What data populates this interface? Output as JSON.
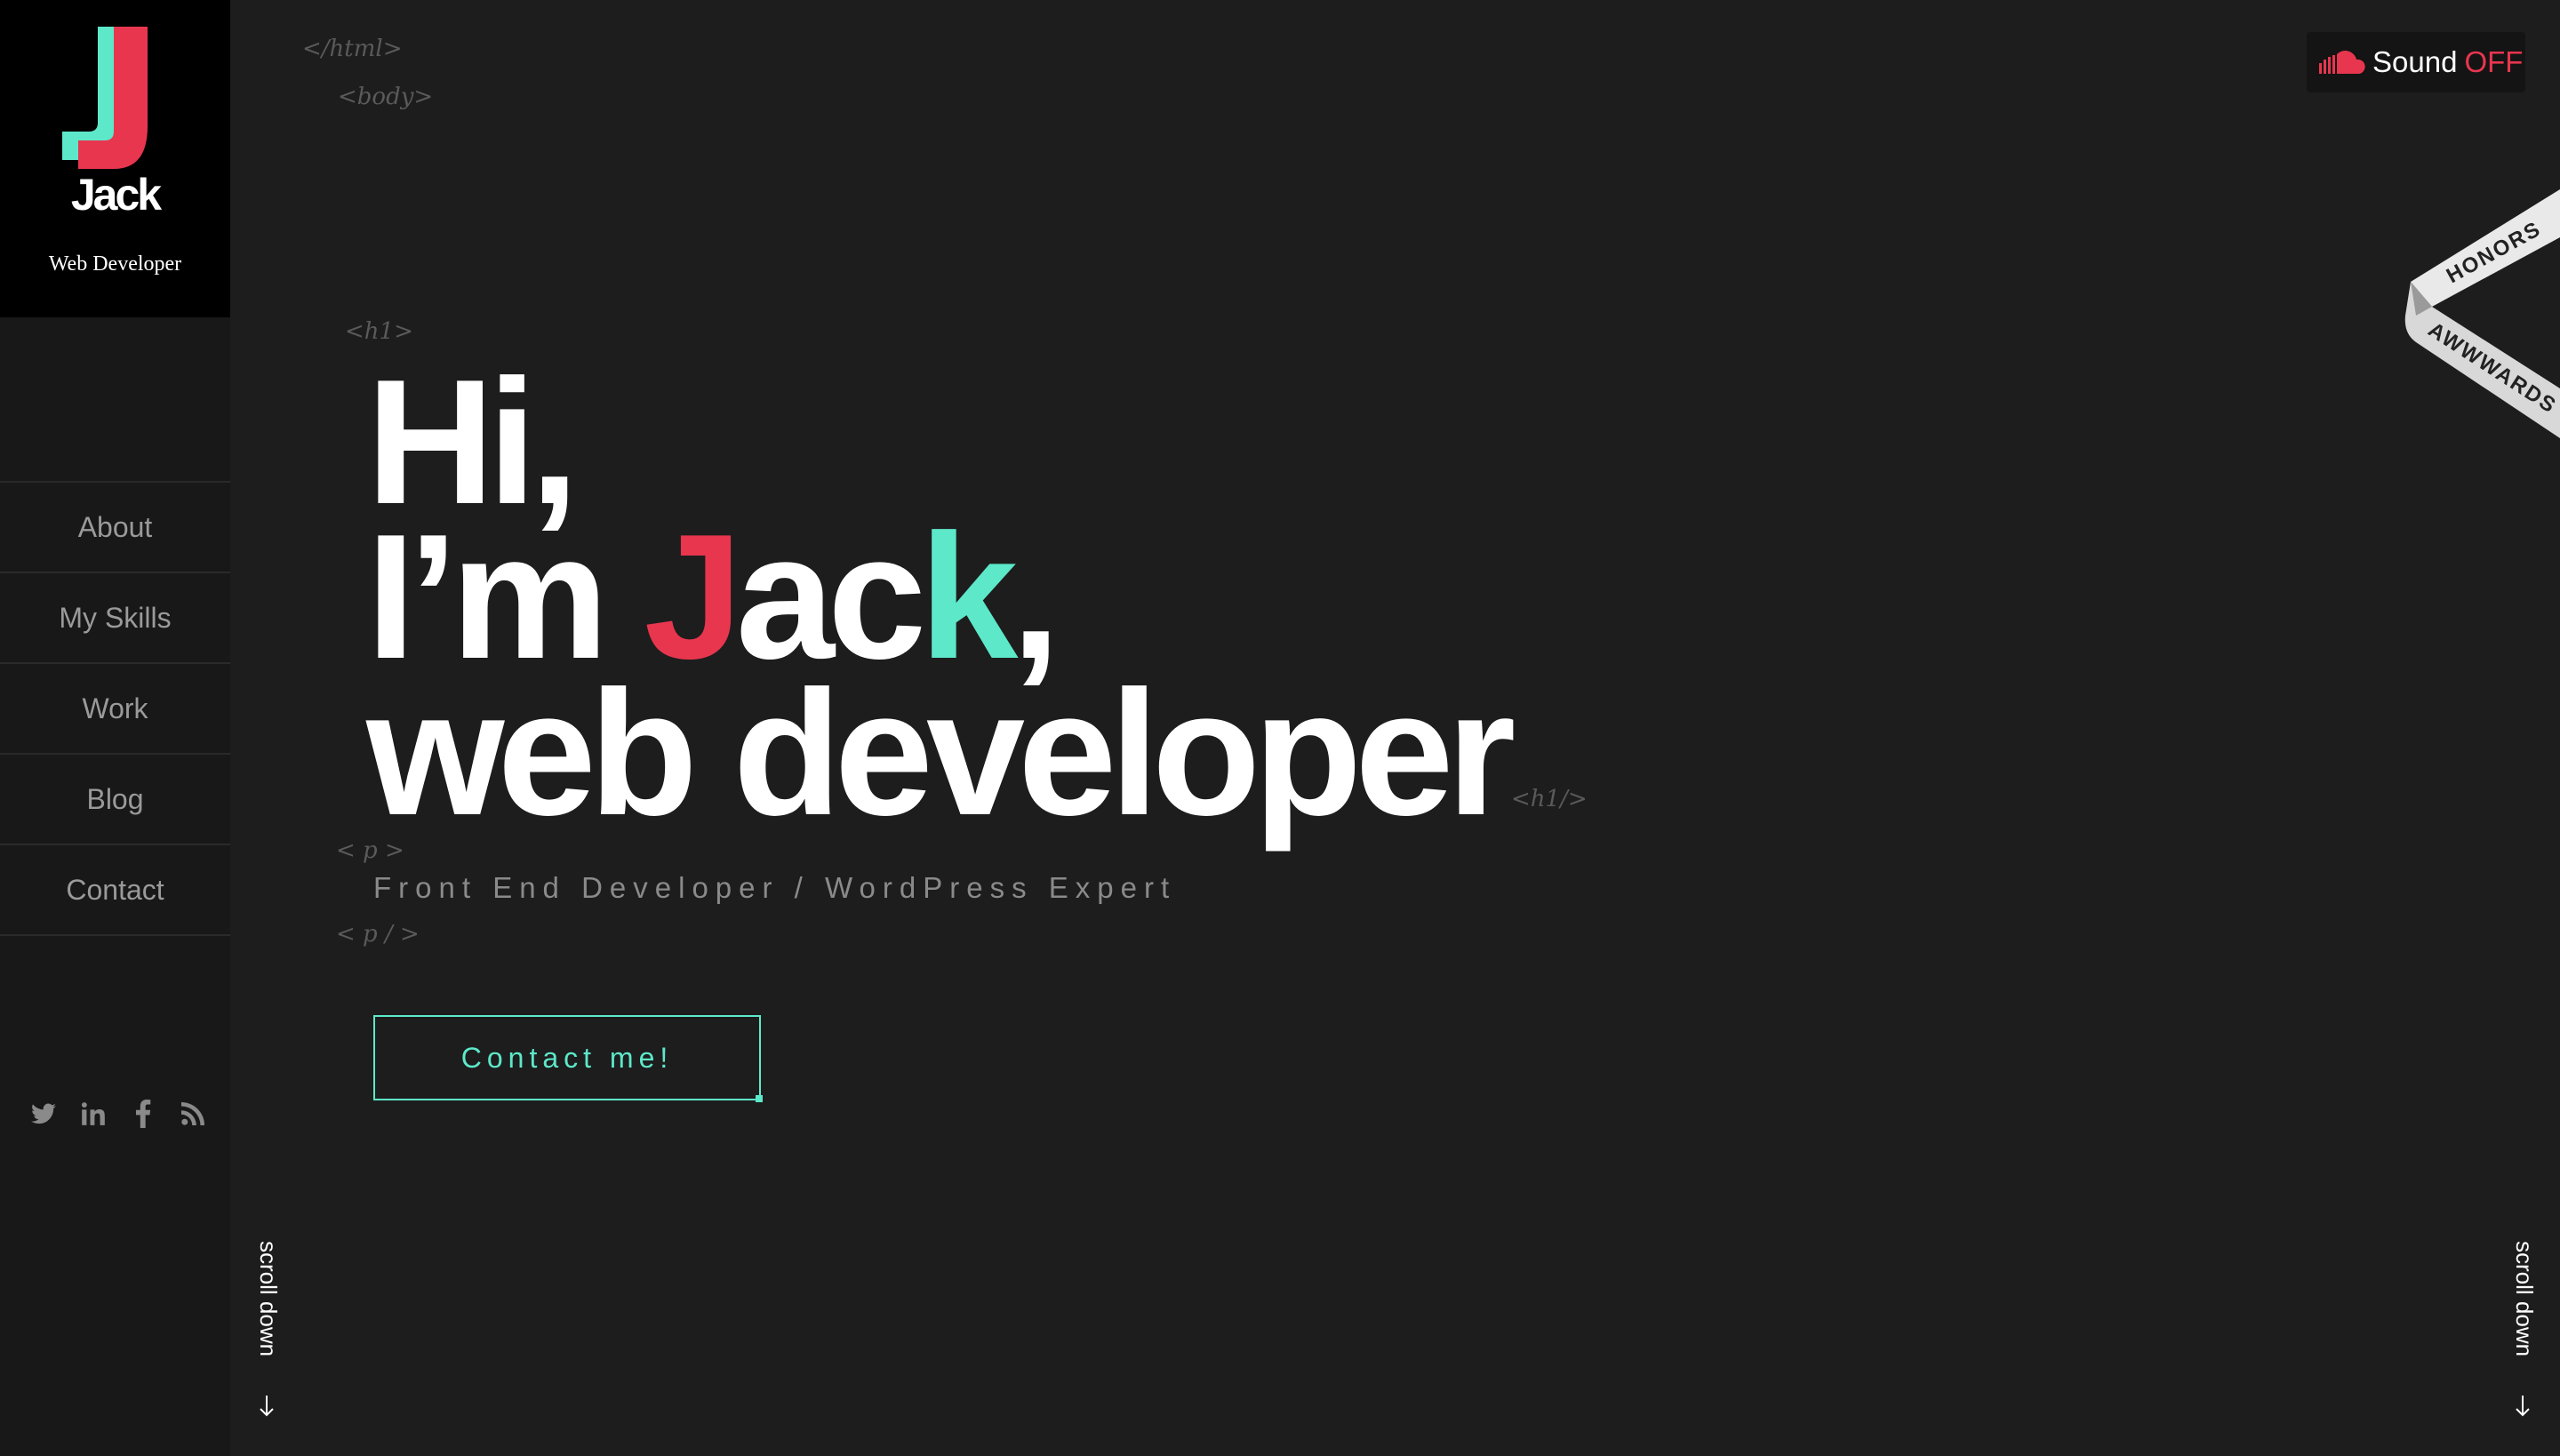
{
  "brand": {
    "name": "Jack",
    "tagline": "Web Developer"
  },
  "nav": {
    "items": [
      {
        "label": "About",
        "key": "about"
      },
      {
        "label": "My Skills",
        "key": "my-skills"
      },
      {
        "label": "Work",
        "key": "work"
      },
      {
        "label": "Blog",
        "key": "blog"
      },
      {
        "label": "Contact",
        "key": "contact"
      }
    ]
  },
  "social": {
    "icons": [
      "twitter-icon",
      "linkedin-icon",
      "facebook-icon",
      "rss-icon"
    ]
  },
  "code_tags": {
    "html_close": "</html>",
    "body_open": "<body>",
    "h1_open": "<h1>",
    "h1_close": "<h1/>",
    "p_open": "< p >",
    "p_close": "< p / >"
  },
  "hero": {
    "line1": "Hi,",
    "line2_prefix": "I’m ",
    "name_j": "J",
    "name_ac": "ac",
    "name_k": "k",
    "line2_suffix": ",",
    "line3": "web developer",
    "subtitle": "Front End Developer / WordPress Expert",
    "cta": "Contact me!"
  },
  "sound": {
    "label": "Sound",
    "state": "OFF",
    "icon": "soundcloud-icon"
  },
  "ribbon": {
    "top": "HONORS",
    "bottom": "AWWWARDS"
  },
  "scroll": {
    "label": "scroll down"
  },
  "colors": {
    "background": "#1d1d1d",
    "sidebar": "#181818",
    "accent_red": "#e8364f",
    "accent_teal": "#5de8c9",
    "text": "#ffffff",
    "muted": "#8a8a8a"
  }
}
